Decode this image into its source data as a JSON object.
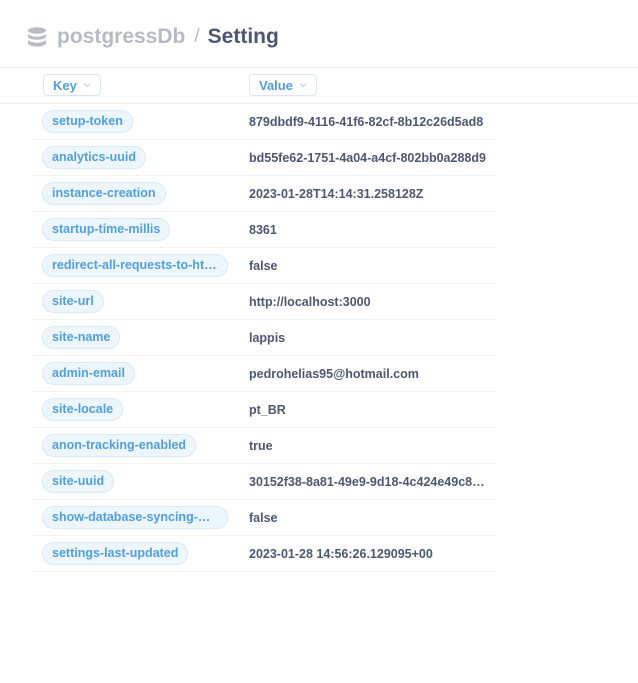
{
  "breadcrumb": {
    "database": "postgressDb",
    "separator": "/",
    "table": "Setting"
  },
  "columns": [
    "Key",
    "Value"
  ],
  "rows": [
    {
      "key": "setup-token",
      "value": "879dbdf9-4116-41f6-82cf-8b12c26d5ad8"
    },
    {
      "key": "analytics-uuid",
      "value": "bd55fe62-1751-4a04-a4cf-802bb0a288d9"
    },
    {
      "key": "instance-creation",
      "value": "2023-01-28T14:14:31.258128Z"
    },
    {
      "key": "startup-time-millis",
      "value": "8361"
    },
    {
      "key": "redirect-all-requests-to-https",
      "value": "false"
    },
    {
      "key": "site-url",
      "value": "http://localhost:3000"
    },
    {
      "key": "site-name",
      "value": "lappis"
    },
    {
      "key": "admin-email",
      "value": "pedrohelias95@hotmail.com"
    },
    {
      "key": "site-locale",
      "value": "pt_BR"
    },
    {
      "key": "anon-tracking-enabled",
      "value": "true"
    },
    {
      "key": "site-uuid",
      "value": "30152f38-8a81-49e9-9d18-4c424e49c8…"
    },
    {
      "key": "show-database-syncing-mo…",
      "value": "false"
    },
    {
      "key": "settings-last-updated",
      "value": "2023-01-28 14:56:26.129095+00"
    }
  ],
  "icons": {
    "database": "database-icon",
    "sort": "chevron-down-icon"
  },
  "colors": {
    "accent": "#509ee3",
    "text": "#4c5773",
    "muted": "#b8bbc3"
  }
}
